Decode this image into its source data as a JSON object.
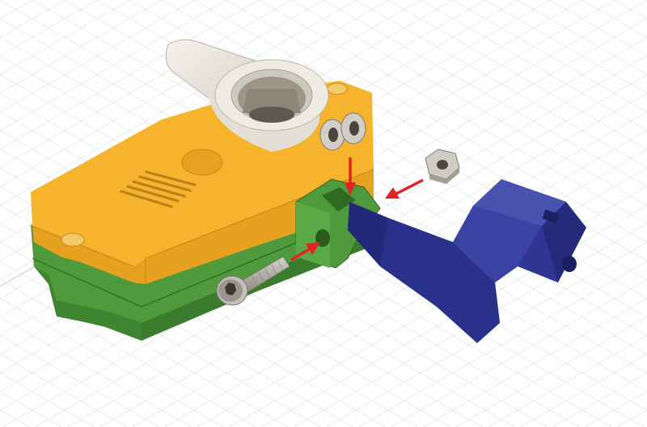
{
  "viewport": {
    "background": "#ffffff",
    "grid_visible": true,
    "grid_color": "#d4d8de",
    "grid_axis_color": "#e8a0a0"
  },
  "assembly": {
    "parts": [
      {
        "name": "enclosure-top",
        "color": "#f5b32e"
      },
      {
        "name": "enclosure-bottom",
        "color": "#4e9a3c"
      },
      {
        "name": "rotary-knob",
        "color": "#ece7dd"
      },
      {
        "name": "hinge-clip",
        "color": "#4e9a3c"
      },
      {
        "name": "washers",
        "color": "#c4c0b8"
      },
      {
        "name": "hex-nut",
        "color": "#c9c5bd"
      },
      {
        "name": "socket-cap-screw",
        "color": "#b7b3ac"
      },
      {
        "name": "z-bracket-arm",
        "color": "#2e3592"
      }
    ],
    "assembly_arrows": {
      "color": "#e52222",
      "count": 3
    }
  }
}
